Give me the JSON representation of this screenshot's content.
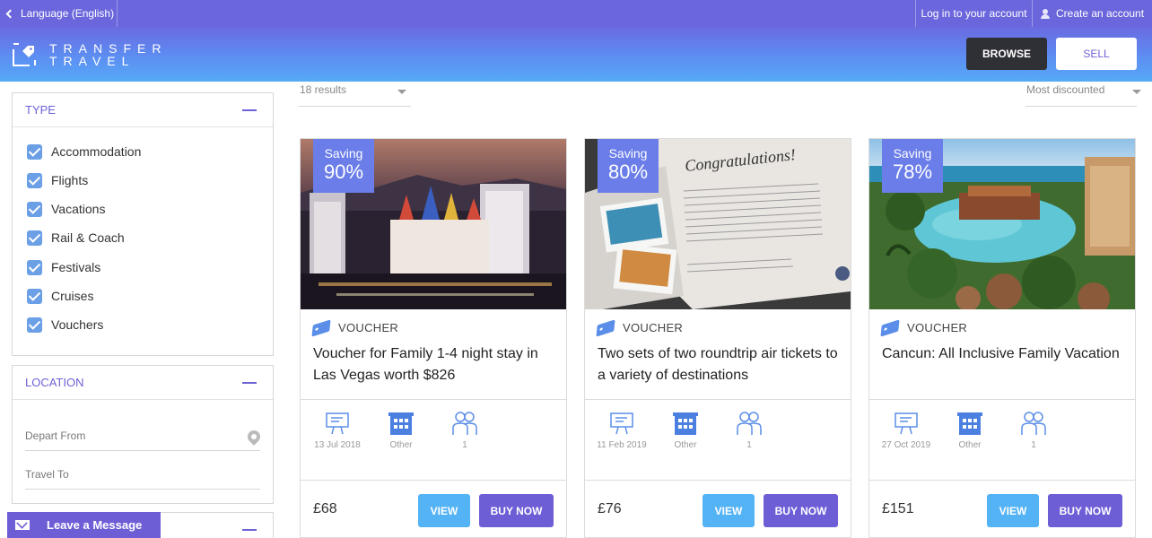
{
  "topbar": {
    "language": "Language (English)",
    "login": "Log in to your account",
    "create": "Create an account"
  },
  "header": {
    "logo_line1": "TRANSFER",
    "logo_line2": "TRAVEL",
    "browse": "BROWSE",
    "sell": "SELL"
  },
  "sidebar": {
    "type_title": "TYPE",
    "types": [
      "Accommodation",
      "Flights",
      "Vacations",
      "Rail & Coach",
      "Festivals",
      "Cruises",
      "Vouchers"
    ],
    "location_title": "LOCATION",
    "depart_placeholder": "Depart From",
    "travel_placeholder": "Travel To"
  },
  "results": {
    "count": "18 results",
    "sort": "Most discounted"
  },
  "colors": {
    "accent": "#6d5ed6",
    "view_button": "#54b3f5",
    "saving_badge": "#6a7de8"
  },
  "cards": [
    {
      "saving_label": "Saving",
      "saving_pct": "90%",
      "type": "VOUCHER",
      "title": "Voucher for Family 1-4 night stay in Las Vegas worth $826",
      "date": "13 Jul 2018",
      "accommodation": "Other",
      "people": "1",
      "price": "£68",
      "view": "VIEW",
      "buy": "BUY NOW"
    },
    {
      "saving_label": "Saving",
      "saving_pct": "80%",
      "type": "VOUCHER",
      "title": "Two sets of two roundtrip air tickets to a variety of destinations",
      "date": "11 Feb 2019",
      "accommodation": "Other",
      "people": "1",
      "price": "£76",
      "view": "VIEW",
      "buy": "BUY NOW",
      "image_text": "Congratulations!"
    },
    {
      "saving_label": "Saving",
      "saving_pct": "78%",
      "type": "VOUCHER",
      "title": "Cancun: All Inclusive Family Vacation",
      "date": "27 Oct 2019",
      "accommodation": "Other",
      "people": "1",
      "price": "£151",
      "view": "VIEW",
      "buy": "BUY NOW"
    }
  ],
  "chat": {
    "label": "Leave a Message"
  }
}
